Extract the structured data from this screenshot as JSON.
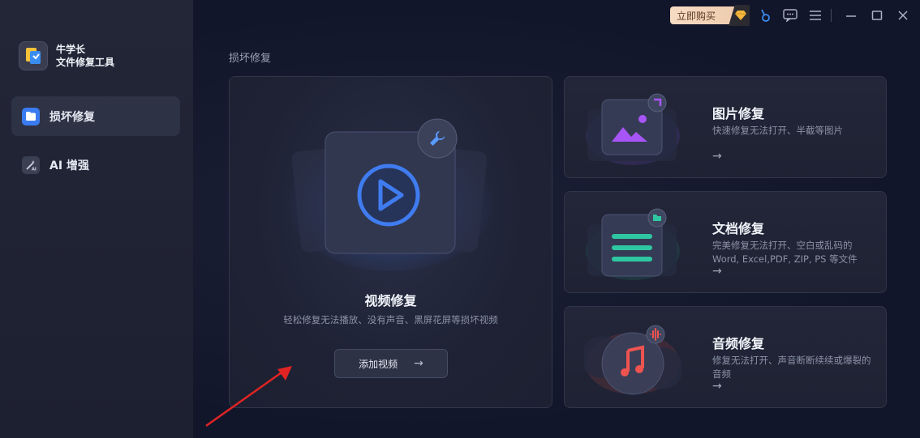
{
  "brand": {
    "line1": "牛学长",
    "line2": "文件修复工具"
  },
  "nav": [
    {
      "label": "损坏修复",
      "active": true,
      "icon": "folder-icon"
    },
    {
      "label": "AI 增强",
      "active": false,
      "icon": "magic-wand-icon"
    }
  ],
  "titlebar": {
    "buy_label": "立即购买"
  },
  "section_title": "损坏修复",
  "video_card": {
    "title": "视频修复",
    "subtitle": "轻松修复无法播放、没有声音、黑屏花屏等损坏视频",
    "button_label": "添加视频",
    "button_arrow": "→"
  },
  "cards": [
    {
      "title": "图片修复",
      "desc": "快速修复无法打开、半截等图片",
      "arrow": "→",
      "icon": "image-icon",
      "accent": "#a855f7"
    },
    {
      "title": "文档修复",
      "desc": "完美修复无法打开、空白或乱码的 Word, Excel,PDF, ZIP, PS 等文件",
      "arrow": "→",
      "icon": "document-icon",
      "accent": "#2fc7a2"
    },
    {
      "title": "音频修复",
      "desc": "修复无法打开、声音断断续续或爆裂的音频",
      "arrow": "→",
      "icon": "music-note-icon",
      "accent": "#ef5350"
    }
  ],
  "colors": {
    "accent_blue": "#3a7bf0",
    "buy_gold": "#f2d2b6",
    "annotation_red": "#e02424"
  }
}
